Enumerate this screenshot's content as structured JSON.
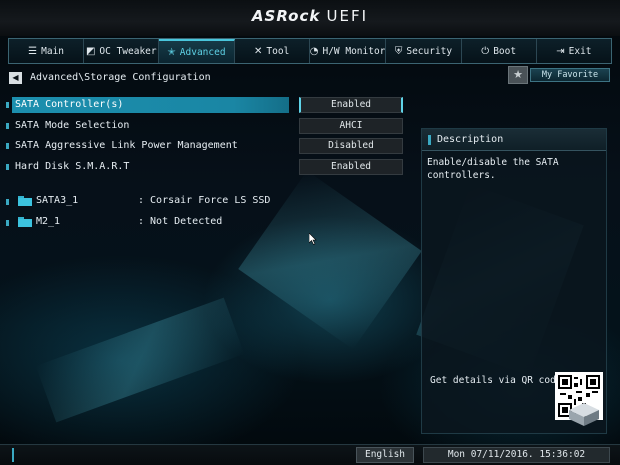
{
  "header": {
    "brand": "ASRock",
    "product": "UEFI"
  },
  "tabs": [
    {
      "label": "Main",
      "icon": "list-icon"
    },
    {
      "label": "OC Tweaker",
      "icon": "oc-icon"
    },
    {
      "label": "Advanced",
      "icon": "star-icon",
      "active": true
    },
    {
      "label": "Tool",
      "icon": "tool-icon"
    },
    {
      "label": "H/W Monitor",
      "icon": "monitor-icon"
    },
    {
      "label": "Security",
      "icon": "shield-icon"
    },
    {
      "label": "Boot",
      "icon": "power-icon"
    },
    {
      "label": "Exit",
      "icon": "exit-icon"
    }
  ],
  "breadcrumb": "Advanced\\Storage Configuration",
  "favorite": {
    "label": "My Favorite"
  },
  "settings": [
    {
      "label": "SATA Controller(s)",
      "value": "Enabled",
      "selected": true
    },
    {
      "label": "SATA Mode Selection",
      "value": "AHCI"
    },
    {
      "label": "SATA Aggressive Link Power Management",
      "value": "Disabled"
    },
    {
      "label": "Hard Disk S.M.A.R.T",
      "value": "Enabled"
    }
  ],
  "drives": [
    {
      "port": "SATA3_1",
      "device": ": Corsair Force LS SSD"
    },
    {
      "port": "M2_1",
      "device": ": Not Detected"
    }
  ],
  "description": {
    "title": "Description",
    "text": "Enable/disable the SATA controllers.",
    "qr_label": "Get details via QR code"
  },
  "footer": {
    "language": "English",
    "datetime": "Mon 07/11/2016. 15:36:02"
  },
  "colors": {
    "accent": "#1c8fae",
    "highlight": "#5fd3e8"
  }
}
